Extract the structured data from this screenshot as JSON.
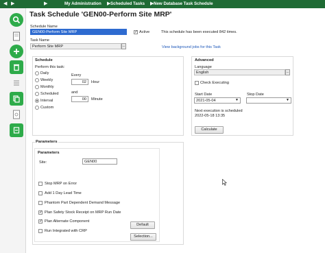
{
  "breadcrumb": {
    "items": [
      "My Administration",
      "Scheduled Tasks",
      "New Database Task Schedule"
    ]
  },
  "sidebar": {
    "icons": [
      "search-icon",
      "document-icon",
      "add-icon",
      "delete-icon",
      "list-icon",
      "copy-icon",
      "report-icon",
      "export-icon"
    ]
  },
  "page": {
    "title": "Task Schedule 'GEN00-Perform Site MRP'"
  },
  "header": {
    "schedule_name_label": "Schedule Name",
    "schedule_name_value": "GEN00-Perform Site MRP",
    "active_label": "Active",
    "active_checked": true,
    "executed_text": "This schedule has been executed 842 times.",
    "task_name_label": "Task Name",
    "task_name_value": "Perform Site MRP",
    "task_name_button": "...",
    "view_jobs_link": "View background jobs for this Task"
  },
  "schedule": {
    "title": "Schedule",
    "perform_label": "Perform this task:",
    "options": [
      "Daily",
      "Weekly",
      "Monthly",
      "Scheduled",
      "Interval",
      "Custom"
    ],
    "selected": "Interval",
    "every_label": "Every",
    "hour_value": "02",
    "hour_label": "Hour",
    "and_label": "and",
    "minute_value": "00",
    "minute_label": "Minute"
  },
  "advanced": {
    "title": "Advanced",
    "language_label": "Language",
    "language_value": "English",
    "language_button": "...",
    "check_executing_label": "Check Executing",
    "start_date_label": "Start Date",
    "start_date_value": "2021-05-04",
    "stop_date_label": "Stop Date",
    "stop_date_value": "",
    "next_exec_label": "Next execution is scheduled",
    "next_exec_value": "2022-05-18 13:35",
    "calculate_button": "Calculate"
  },
  "parameters": {
    "outer_title": "Parameters",
    "inner_title": "Parameters",
    "site_label": "Site:",
    "site_value": "GEN00",
    "options": [
      {
        "label": "Stop MRP on Error",
        "checked": false
      },
      {
        "label": "Add 1 Day Lead Time",
        "checked": false
      },
      {
        "label": "Phantom Part Dependent Demand Message",
        "checked": false
      },
      {
        "label": "Plan Safety Stock Receipt on MRP Run Date",
        "checked": true
      },
      {
        "label": "Plan Alternate Component",
        "checked": true
      },
      {
        "label": "Run Integrated with CRP",
        "checked": false
      }
    ],
    "default_button": "Default",
    "selection_button": "Selection..."
  }
}
